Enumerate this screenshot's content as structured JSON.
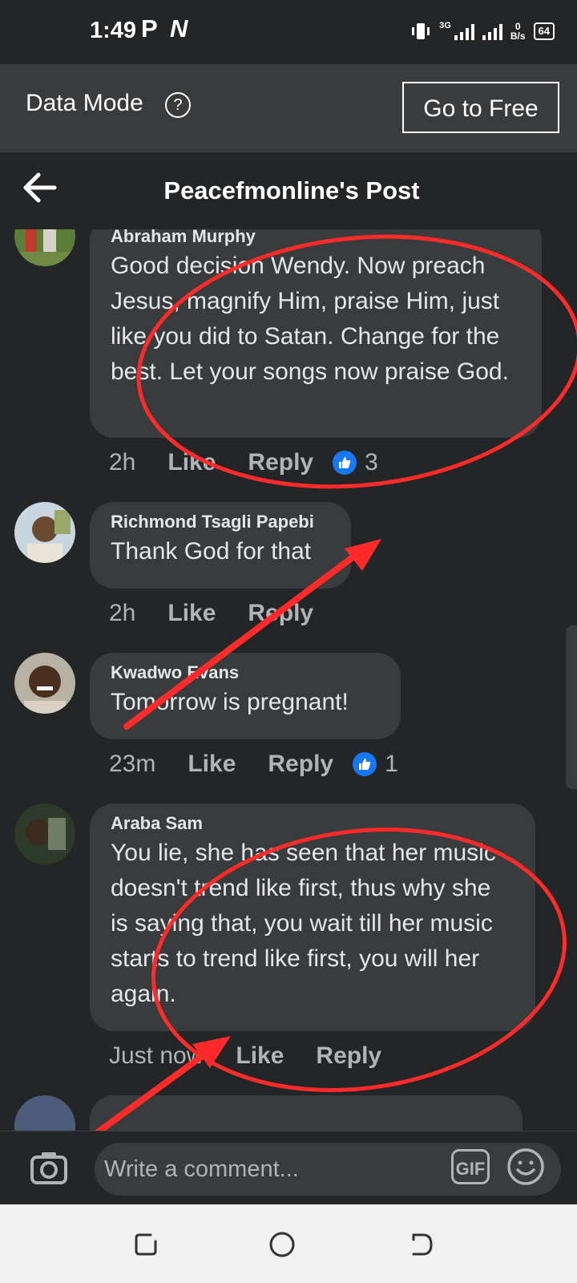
{
  "status_bar": {
    "time": "1:49",
    "left_icons": [
      "P",
      "N"
    ],
    "network": "3G",
    "speed_value": "0",
    "speed_unit": "B/s",
    "battery": "64"
  },
  "data_mode_bar": {
    "label": "Data Mode",
    "help_icon": "question-circle-icon",
    "button": "Go to Free"
  },
  "header": {
    "back_icon": "arrow-left-icon",
    "title": "Peacefmonline's Post"
  },
  "comments": [
    {
      "author": "Abraham Murphy",
      "text": "Good decision Wendy. Now preach Jesus, magnify Him, praise Him, just like you did to Satan. Change for the best. Let your songs now praise God.",
      "time": "2h",
      "like_label": "Like",
      "reply_label": "Reply",
      "reaction_count": "3"
    },
    {
      "author": "Richmond Tsagli Papebi",
      "text": "Thank God for that",
      "time": "2h",
      "like_label": "Like",
      "reply_label": "Reply"
    },
    {
      "author": "Kwadwo Evans",
      "text": "Tomorrow is pregnant!",
      "time": "23m",
      "like_label": "Like",
      "reply_label": "Reply",
      "reaction_count": "1"
    },
    {
      "author": "Araba Sam",
      "text": "You lie, she has seen that her music doesn't trend like first, thus why she is saying that, you wait till her music starts to trend like first, you will her again.",
      "time": "Just now",
      "like_label": "Like",
      "reply_label": "Reply"
    }
  ],
  "comment_bar": {
    "camera_icon": "camera-icon",
    "placeholder": "Write a comment...",
    "gif_label": "GIF",
    "emoji_icon": "smiley-icon"
  },
  "nav_bar": {
    "icons": [
      "recent-apps-icon",
      "home-icon",
      "back-icon"
    ]
  },
  "colors": {
    "background": "#242526",
    "bubble": "#3a3b3c",
    "text": "#e4e6eb",
    "secondary_text": "#b0b3b8",
    "like_blue": "#1877f2",
    "annotation_red": "#ff2a2a"
  }
}
